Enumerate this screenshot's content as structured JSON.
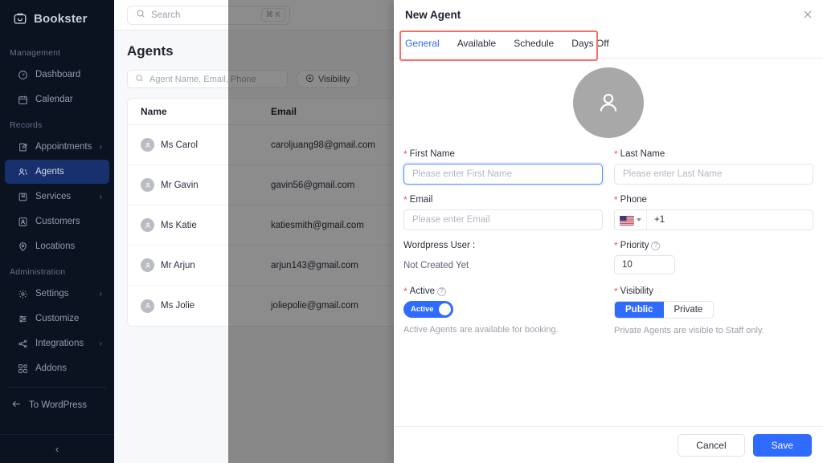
{
  "sidebar": {
    "brand": "Bookster",
    "sections": [
      {
        "title": "Management",
        "items": [
          {
            "label": "Dashboard",
            "icon": "gauge-icon",
            "chevron": "",
            "active": false
          },
          {
            "label": "Calendar",
            "icon": "calendar-icon",
            "chevron": "",
            "active": false
          }
        ]
      },
      {
        "title": "Records",
        "items": [
          {
            "label": "Appointments",
            "icon": "appointments-icon",
            "chevron": "›",
            "active": false
          },
          {
            "label": "Agents",
            "icon": "agents-icon",
            "chevron": "",
            "active": true
          },
          {
            "label": "Services",
            "icon": "services-icon",
            "chevron": "›",
            "active": false
          },
          {
            "label": "Customers",
            "icon": "customers-icon",
            "chevron": "",
            "active": false
          },
          {
            "label": "Locations",
            "icon": "location-pin-icon",
            "chevron": "",
            "active": false
          }
        ]
      },
      {
        "title": "Administration",
        "items": [
          {
            "label": "Settings",
            "icon": "gear-icon",
            "chevron": "›",
            "active": false
          },
          {
            "label": "Customize",
            "icon": "sliders-icon",
            "chevron": "",
            "active": false
          },
          {
            "label": "Integrations",
            "icon": "share-nodes-icon",
            "chevron": "›",
            "active": false
          },
          {
            "label": "Addons",
            "icon": "addons-grid-icon",
            "chevron": "",
            "active": false
          }
        ]
      }
    ],
    "to_wordpress": "To WordPress",
    "collapse_glyph": "‹",
    "active_bg": "#19306e"
  },
  "topbar": {
    "search_placeholder": "Search",
    "shortcut": "⌘ K"
  },
  "agents_page": {
    "title": "Agents",
    "filter_placeholder": "Agent Name, Email, Phone",
    "visibility_button": "Visibility",
    "columns": [
      "Name",
      "Email"
    ],
    "rows": [
      {
        "name": "Ms Carol",
        "email": "caroljuang98@gmail.com"
      },
      {
        "name": "Mr Gavin",
        "email": "gavin56@gmail.com"
      },
      {
        "name": "Ms Katie",
        "email": "katiesmith@gmail.com"
      },
      {
        "name": "Mr Arjun",
        "email": "arjun143@gmail.com"
      },
      {
        "name": "Ms Jolie",
        "email": "joliepolie@gmail.com"
      }
    ]
  },
  "drawer": {
    "title": "New Agent",
    "tabs": [
      {
        "label": "General",
        "active": true
      },
      {
        "label": "Available",
        "active": false
      },
      {
        "label": "Schedule",
        "active": false
      },
      {
        "label": "Days Off",
        "active": false
      }
    ],
    "highlight_color": "#f4706a",
    "accent_color": "#2f6bff",
    "form": {
      "first_name": {
        "label": "First Name",
        "required": true,
        "placeholder": "Please enter First Name",
        "value": "",
        "focused": true
      },
      "last_name": {
        "label": "Last Name",
        "required": true,
        "placeholder": "Please enter Last Name",
        "value": ""
      },
      "email": {
        "label": "Email",
        "required": true,
        "placeholder": "Please enter Email",
        "value": ""
      },
      "phone": {
        "label": "Phone",
        "required": true,
        "country": "US",
        "dial_code": "+1"
      },
      "wordpress_user": {
        "label": "Wordpress User :",
        "value": "Not Created Yet"
      },
      "priority": {
        "label": "Priority",
        "required": true,
        "value": "10",
        "help": "?"
      },
      "active": {
        "label": "Active",
        "required": true,
        "help": "?",
        "toggle_text": "Active",
        "on": true,
        "helper": "Active Agents are available for booking."
      },
      "visibility": {
        "label": "Visibility",
        "required": true,
        "options": [
          "Public",
          "Private"
        ],
        "selected": "Public",
        "helper": "Private Agents are visible to Staff only."
      }
    },
    "footer": {
      "cancel": "Cancel",
      "save": "Save"
    }
  }
}
